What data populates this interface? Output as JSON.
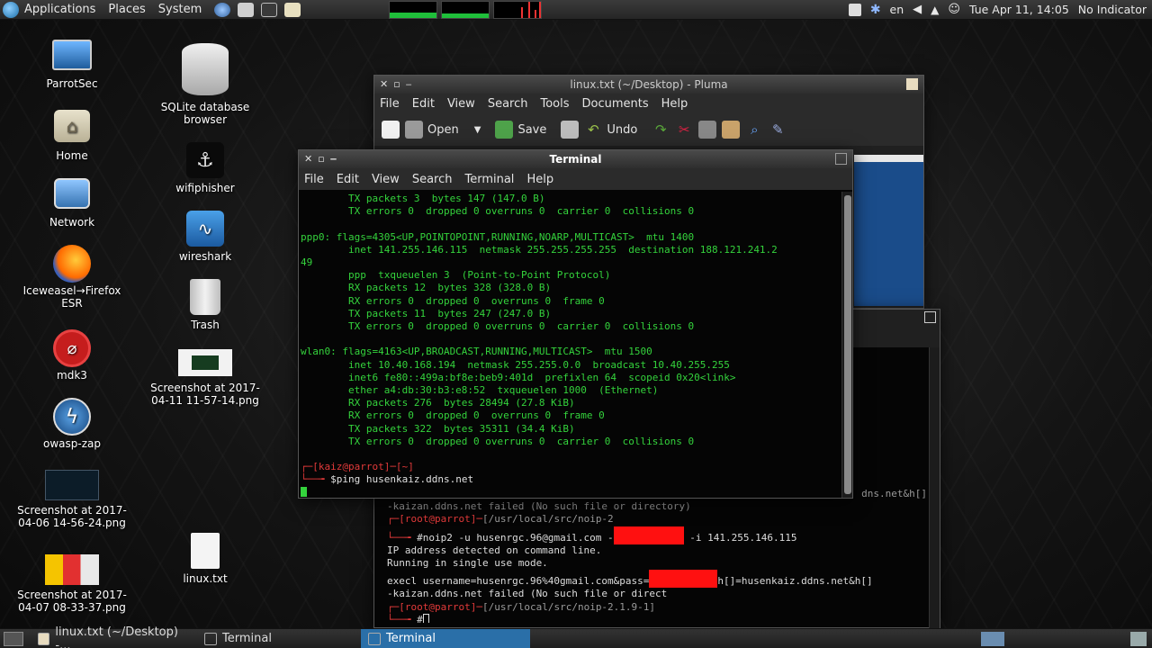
{
  "top_panel": {
    "menus": [
      "Applications",
      "Places",
      "System"
    ],
    "language": "en",
    "clock": "Tue Apr 11, 14:05",
    "indicator": "No Indicator"
  },
  "desktop_icons": [
    {
      "label": "ParrotSec",
      "icon": "computer-icon"
    },
    {
      "label": "Home",
      "icon": "home-folder-icon"
    },
    {
      "label": "Network",
      "icon": "network-icon"
    },
    {
      "label": "Iceweasel→Firefox ESR",
      "icon": "firefox-icon"
    },
    {
      "label": "mdk3",
      "icon": "mdk3-icon"
    },
    {
      "label": "owasp-zap",
      "icon": "owasp-zap-icon"
    },
    {
      "label": "Screenshot at 2017-04-06 14-56-24.png",
      "icon": "image-thumbnail-icon"
    },
    {
      "label": "Screenshot at 2017-04-07 08-33-37.png",
      "icon": "image-thumbnail-icon"
    },
    {
      "label": "SQLite database browser",
      "icon": "database-icon"
    },
    {
      "label": "wifiphisher",
      "icon": "wifiphisher-icon"
    },
    {
      "label": "wireshark",
      "icon": "wireshark-icon"
    },
    {
      "label": "Trash",
      "icon": "trash-icon"
    },
    {
      "label": "Screenshot at 2017-04-11 11-57-14.png",
      "icon": "image-thumbnail-icon"
    },
    {
      "label": "linux.txt",
      "icon": "text-file-icon"
    }
  ],
  "pluma": {
    "title": "linux.txt (~/Desktop) - Pluma",
    "menu": [
      "File",
      "Edit",
      "View",
      "Search",
      "Tools",
      "Documents",
      "Help"
    ],
    "toolbar": {
      "open": "Open",
      "save": "Save",
      "undo": "Undo"
    }
  },
  "terminal_front": {
    "title": "Terminal",
    "menu": [
      "File",
      "Edit",
      "View",
      "Search",
      "Terminal",
      "Help"
    ],
    "lines": [
      "        TX packets 3  bytes 147 (147.0 B)",
      "        TX errors 0  dropped 0 overruns 0  carrier 0  collisions 0",
      "",
      "ppp0: flags=4305<UP,POINTOPOINT,RUNNING,NOARP,MULTICAST>  mtu 1400",
      "        inet 141.255.146.115  netmask 255.255.255.255  destination 188.121.241.2",
      "49",
      "        ppp  txqueuelen 3  (Point-to-Point Protocol)",
      "        RX packets 12  bytes 328 (328.0 B)",
      "        RX errors 0  dropped 0  overruns 0  frame 0",
      "        TX packets 11  bytes 247 (247.0 B)",
      "        TX errors 0  dropped 0 overruns 0  carrier 0  collisions 0",
      "",
      "wlan0: flags=4163<UP,BROADCAST,RUNNING,MULTICAST>  mtu 1500",
      "        inet 10.40.168.194  netmask 255.255.0.0  broadcast 10.40.255.255",
      "        inet6 fe80::499a:bf8e:beb9:401d  prefixlen 64  scopeid 0x20<link>",
      "        ether a4:db:30:b3:e8:52  txqueuelen 1000  (Ethernet)",
      "        RX packets 276  bytes 28494 (27.8 KiB)",
      "        RX errors 0  dropped 0  overruns 0  frame 0",
      "        TX packets 322  bytes 35311 (34.4 KiB)",
      "        TX errors 0  dropped 0 overruns 0  carrier 0  collisions 0",
      ""
    ],
    "prompt_user": "kaiz@parrot",
    "prompt_dir": "[~]",
    "command": "$ping husenkaiz.ddns.net"
  },
  "terminal_back": {
    "line1_tail": "dns.net&h[]",
    "line2": "-kaizan.ddns.net failed (No such file or directory)",
    "prompt1_user": "root@parrot",
    "prompt1_dir": "[/usr/local/src/noip-2",
    "cmd_prefix": "#noip2 -u husenrgc.96@gmail.com -",
    "cmd_suffix": " -i 141.255.146.115",
    "line4": "IP address detected on command line.",
    "line5": "Running in single use mode.",
    "line6_prefix": "execl username=husenrgc.96%40gmail.com&pass=",
    "line6_suffix": "h[]=husenkaiz.ddns.net&h[]",
    "line7": "-kaizan.ddns.net failed (No such file or direct",
    "prompt2_user": "root@parrot",
    "prompt2_dir": "[/usr/local/src/noip-2.1.9-1]",
    "prompt2_cmd": "#"
  },
  "taskbar": [
    {
      "label": "linux.txt (~/Desktop) -...",
      "active": false
    },
    {
      "label": "Terminal",
      "active": false
    },
    {
      "label": "Terminal",
      "active": true
    }
  ],
  "colors": {
    "terminal_green": "#34d33c",
    "prompt_red": "#e23a3a",
    "redaction": "#ff1010",
    "active_task": "#2a6fa8"
  }
}
